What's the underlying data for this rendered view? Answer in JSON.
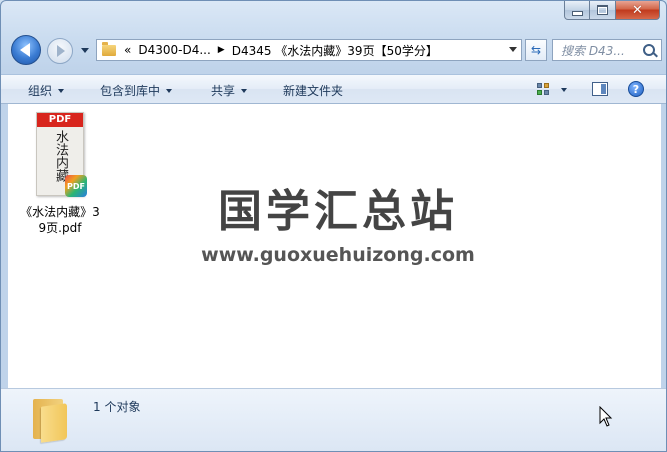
{
  "window": {
    "caption": {
      "minimize": "minimize-icon",
      "maximize": "maximize-icon",
      "close": "close-icon"
    }
  },
  "nav": {
    "back_icon": "back-arrow-icon",
    "forward_icon": "forward-arrow-icon",
    "address": {
      "overflow": "«",
      "segments": [
        "D4300-D4...",
        "D4345 《水法内藏》39页【50学分】"
      ]
    },
    "refresh_icon": "refresh-icon",
    "search_placeholder": "搜索 D43..."
  },
  "toolbar": {
    "organize": "组织",
    "include_in_library": "包含到库中",
    "share": "共享",
    "new_folder": "新建文件夹",
    "view_icon": "view-options-icon",
    "preview_pane_icon": "preview-pane-icon",
    "help": "?"
  },
  "content": {
    "files": [
      {
        "name": "《水法内藏》39页.pdf",
        "thumb_band": "PDF",
        "thumb_title": "水法内藏",
        "badge": "PDF"
      }
    ],
    "watermark": {
      "title": "国学汇总站",
      "url": "www.guoxuehuizong.com"
    }
  },
  "status": {
    "count": "1 个对象"
  },
  "colors": {
    "pdf_red": "#d8251d",
    "chrome_blue": "#cfe0f1",
    "text": "#1e395b"
  }
}
